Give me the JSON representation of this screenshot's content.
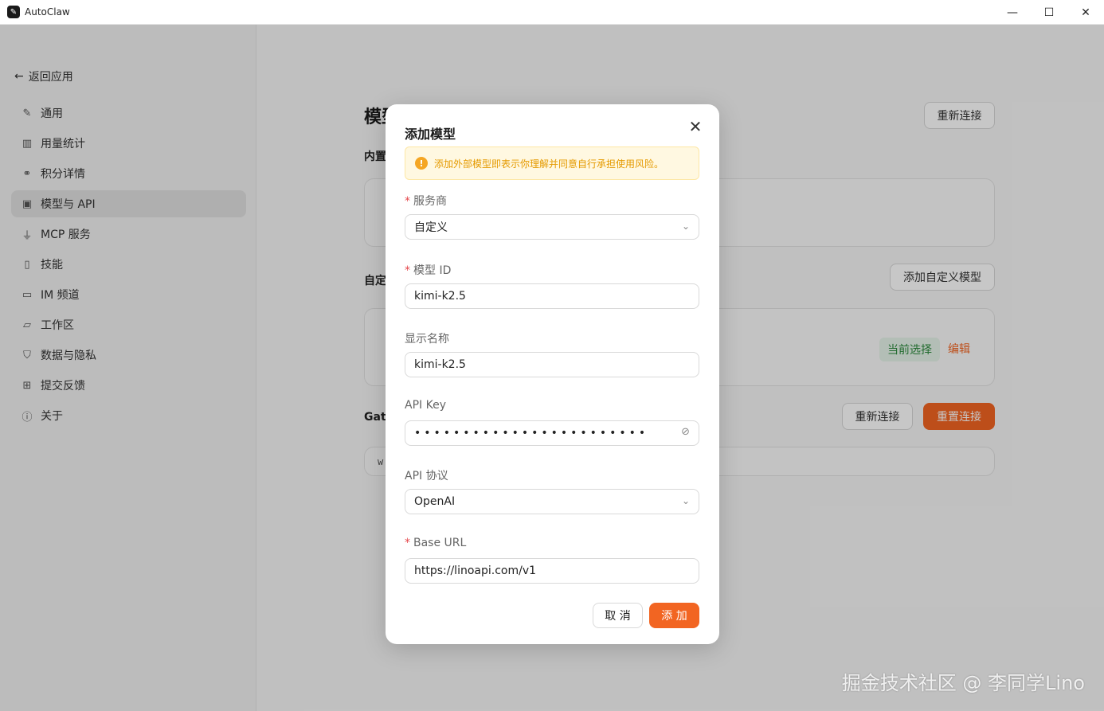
{
  "window": {
    "title": "AutoClaw",
    "minimize_icon": "—",
    "maximize_icon": "☐",
    "close_icon": "✕"
  },
  "sidebar": {
    "back_label": "返回应用",
    "items": [
      {
        "label": "通用",
        "icon": "pen-icon"
      },
      {
        "label": "用量统计",
        "icon": "bar-chart-icon"
      },
      {
        "label": "积分详情",
        "icon": "link-icon"
      },
      {
        "label": "模型与 API",
        "icon": "chip-icon",
        "active": true
      },
      {
        "label": "MCP 服务",
        "icon": "plug-icon"
      },
      {
        "label": "技能",
        "icon": "book-icon"
      },
      {
        "label": "IM 频道",
        "icon": "chat-icon"
      },
      {
        "label": "工作区",
        "icon": "folder-icon"
      },
      {
        "label": "数据与隐私",
        "icon": "shield-icon"
      },
      {
        "label": "提交反馈",
        "icon": "feedback-icon"
      },
      {
        "label": "关于",
        "icon": "info-icon"
      }
    ]
  },
  "main": {
    "title_partial": "模型",
    "reconnect_top": "重新连接",
    "builtin_label": "内置",
    "custom_label": "自定",
    "add_custom_model": "添加自定义模型",
    "current_selection": "当前选择",
    "edit_link": "编辑",
    "gateway_label": "Gat",
    "reconnect": "重新连接",
    "reset_connection": "重置连接",
    "gateway_value_partial": "w"
  },
  "modal": {
    "title": "添加模型",
    "warning": "添加外部模型即表示你理解并同意自行承担使用风险。",
    "provider": {
      "label": "服务商",
      "value": "自定义"
    },
    "model_id": {
      "label": "模型 ID",
      "value": "kimi-k2.5"
    },
    "display_name": {
      "label": "显示名称",
      "value": "kimi-k2.5"
    },
    "api_key": {
      "label": "API Key",
      "value": "••••••••••••••••••••••••"
    },
    "api_protocol": {
      "label": "API 协议",
      "value": "OpenAI"
    },
    "base_url": {
      "label": "Base URL",
      "value": "https://linoapi.com/v1"
    },
    "cancel": "取 消",
    "confirm": "添 加"
  },
  "watermark": "掘金技术社区 @ 李同学Lino",
  "colors": {
    "accent": "#f26522",
    "warning_bg": "#fff8e1",
    "success": "#2e8b3e"
  }
}
